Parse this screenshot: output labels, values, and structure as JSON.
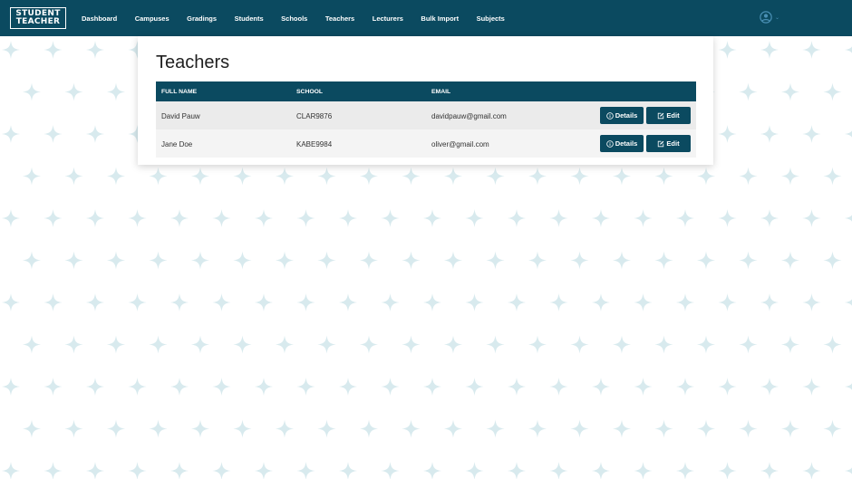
{
  "brand": {
    "line1": "STUDENT",
    "line2": "TEACHER"
  },
  "nav": {
    "items": [
      {
        "label": "Dashboard"
      },
      {
        "label": "Campuses"
      },
      {
        "label": "Gradings"
      },
      {
        "label": "Students"
      },
      {
        "label": "Schools"
      },
      {
        "label": "Teachers"
      },
      {
        "label": "Lecturers"
      },
      {
        "label": "Bulk Import"
      },
      {
        "label": "Subjects"
      }
    ],
    "user_icon": "user-circle-icon",
    "caret_icon": "caret-down-icon",
    "caret": "⌄"
  },
  "page": {
    "title": "Teachers"
  },
  "table": {
    "headers": {
      "name": "FULL NAME",
      "school": "SCHOOL",
      "email": "EMAIL"
    },
    "rows": [
      {
        "name": "David Pauw",
        "school": "CLAR9876",
        "email": "davidpauw@gmail.com",
        "details": "Details",
        "edit": "Edit"
      },
      {
        "name": "Jane Doe",
        "school": "KABE9984",
        "email": "oliver@gmail.com",
        "details": "Details",
        "edit": "Edit"
      }
    ]
  },
  "colors": {
    "primary": "#0b4a60",
    "pattern": "#d8eaee",
    "user_icon": "#4a90b5"
  }
}
